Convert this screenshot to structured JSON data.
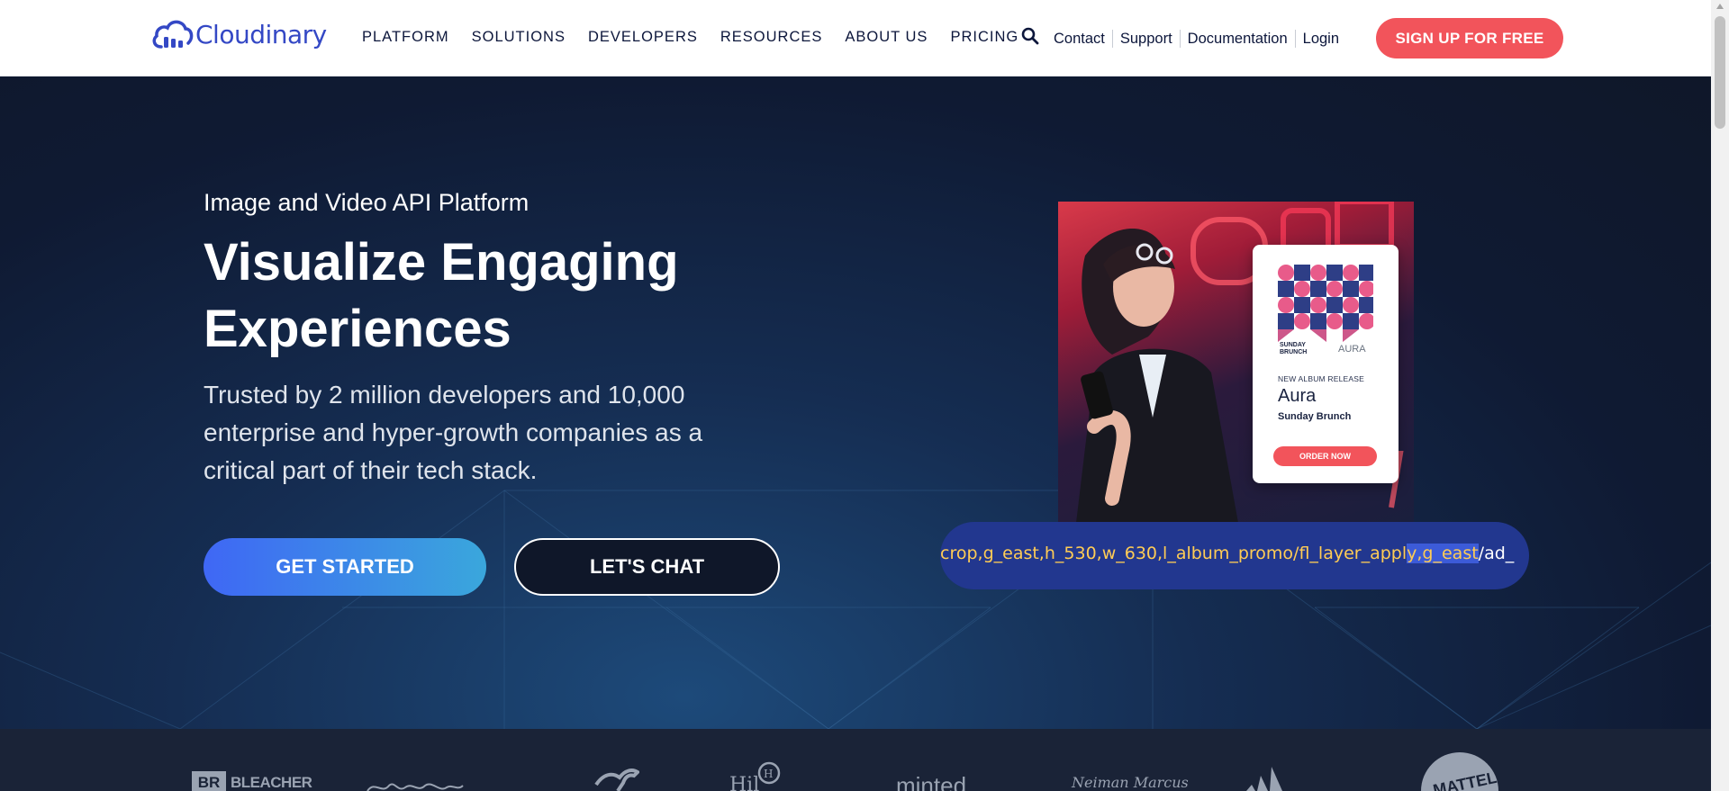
{
  "header": {
    "logo_text": "Cloudinary",
    "nav": [
      "PLATFORM",
      "SOLUTIONS",
      "DEVELOPERS",
      "RESOURCES",
      "ABOUT US",
      "PRICING"
    ],
    "links": [
      "Contact",
      "Support",
      "Documentation",
      "Login"
    ],
    "signup_label": "SIGN UP FOR FREE"
  },
  "hero": {
    "eyebrow": "Image and Video API Platform",
    "headline": "Visualize Engaging Experiences",
    "subtext": "Trusted by 2 million developers and 10,000 enterprise and hyper-growth companies as a critical part of their tech stack.",
    "primary_cta": "GET STARTED",
    "secondary_cta": "LET'S CHAT"
  },
  "promo": {
    "album_tag_1": "SUNDAY BRUNCH",
    "album_tag_2": "AURA",
    "new_release": "NEW ALBUM RELEASE",
    "album_title": "Aura",
    "artist": "Sunday Brunch",
    "order_label": "ORDER NOW"
  },
  "url_bar": {
    "before_highlight": "crop,g_east,h_530,w_630,l_album_promo/fl_layer_appl",
    "highlight": "y,g_east",
    "after_highlight": "/ad_"
  },
  "clients": [
    "BLEACHER",
    "minted",
    "Neiman Marcus",
    "MATTEL"
  ],
  "colors": {
    "brand_blue": "#3448c5",
    "signup_red": "#f2545b",
    "url_text": "#ffcc55"
  }
}
